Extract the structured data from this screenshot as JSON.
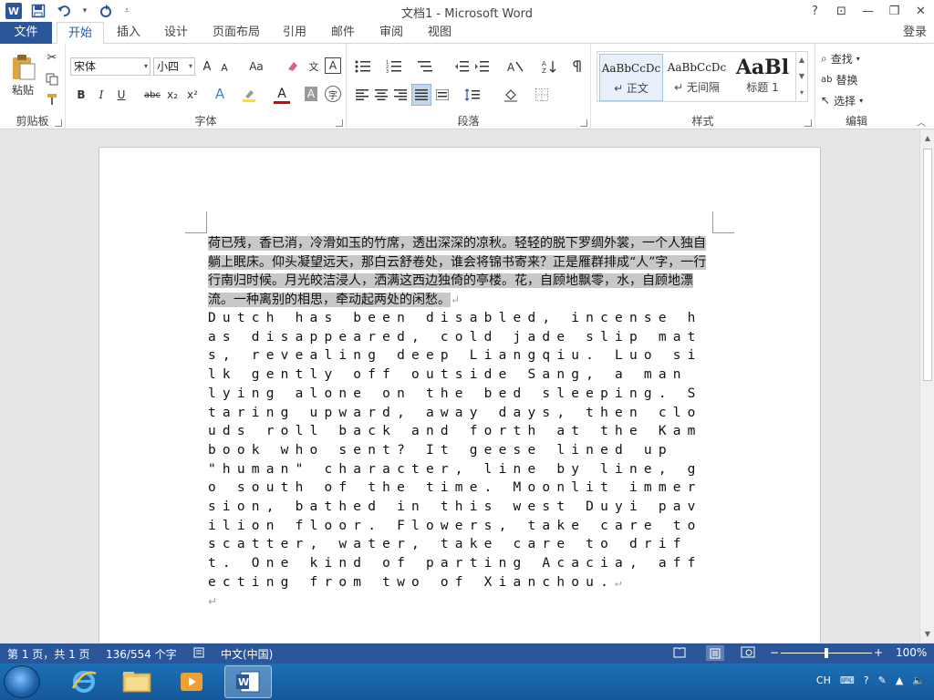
{
  "window": {
    "title": "文档1 - Microsoft Word",
    "app_icon": "W",
    "login": "登录",
    "controls": [
      "?",
      "⊡",
      "—",
      "❐",
      "✕"
    ]
  },
  "qat": {
    "save_icon": "save-icon",
    "undo_icon": "undo-icon",
    "redo_icon": "redo-icon"
  },
  "tabs": [
    {
      "label": "文件"
    },
    {
      "label": "开始"
    },
    {
      "label": "插入"
    },
    {
      "label": "设计"
    },
    {
      "label": "页面布局"
    },
    {
      "label": "引用"
    },
    {
      "label": "邮件"
    },
    {
      "label": "审阅"
    },
    {
      "label": "视图"
    }
  ],
  "ribbon": {
    "clipboard": {
      "label": "剪贴板",
      "paste": "粘贴"
    },
    "font": {
      "label": "字体",
      "font_name": "宋体",
      "font_size": "小四",
      "bold": "B",
      "italic": "I",
      "underline": "U",
      "strike": "abc",
      "subscript": "x₂",
      "superscript": "x²",
      "grow": "A",
      "shrink": "A",
      "case": "Aa",
      "text_effect": "A",
      "font_color": "A",
      "char_shade": "A",
      "enclose": "字",
      "phonetic": "文",
      "char_border": "A"
    },
    "paragraph": {
      "label": "段落"
    },
    "styles": {
      "label": "样式",
      "items": [
        {
          "sample": "AaBbCcDc",
          "name": "↵ 正文"
        },
        {
          "sample": "AaBbCcDc",
          "name": "↵ 无间隔"
        },
        {
          "sample": "AaBl",
          "name": "标题 1"
        }
      ]
    },
    "editing": {
      "label": "编辑",
      "find": "查找",
      "replace": "替换",
      "select": "选择"
    }
  },
  "document": {
    "chinese_paragraph": "荷已残，香已消，冷滑如玉的竹席，透出深深的凉秋。轻轻的脱下罗绸外裳，一个人独自躺上眠床。仰头凝望远天，那白云舒卷处，谁会将锦书寄来？正是雁群排成“人”字，一行行南归时候。月光皎洁浸人，洒满这西边独倚的亭楼。花，自顾地飘零，水，自顾地漂流。一种离别的相思，牵动起两处的闲愁。",
    "english_paragraph": "Dutch has been disabled, incense has disappeared, cold jade slip mats, revealing deep Liangqiu. Luo silk gently off outside Sang, a man lying alone on the bed sleeping. Staring upward, away days, then clouds roll back and forth at the Kam book who sent? It geese lined up \"human\" character, line by line, go south of the time. Moonlit immersion, bathed in this west Duyi pavilion floor. Flowers, take care to scatter, water, take care to drift. One kind of parting Acacia, affecting from two of Xianchou.",
    "pilcrow": "↵"
  },
  "statusbar": {
    "page": "第 1 页，共 1 页",
    "words": "136/554 个字",
    "language": "中文(中国)",
    "zoom": "100%",
    "zoom_minus": "−",
    "zoom_plus": "+"
  },
  "taskbar": {
    "apps": [
      "ie-icon",
      "explorer-icon",
      "media-player-icon",
      "word-icon"
    ],
    "tray": {
      "ime": "CH"
    }
  },
  "colors": {
    "accent": "#2b579a",
    "selection": "#c8c8c8"
  }
}
